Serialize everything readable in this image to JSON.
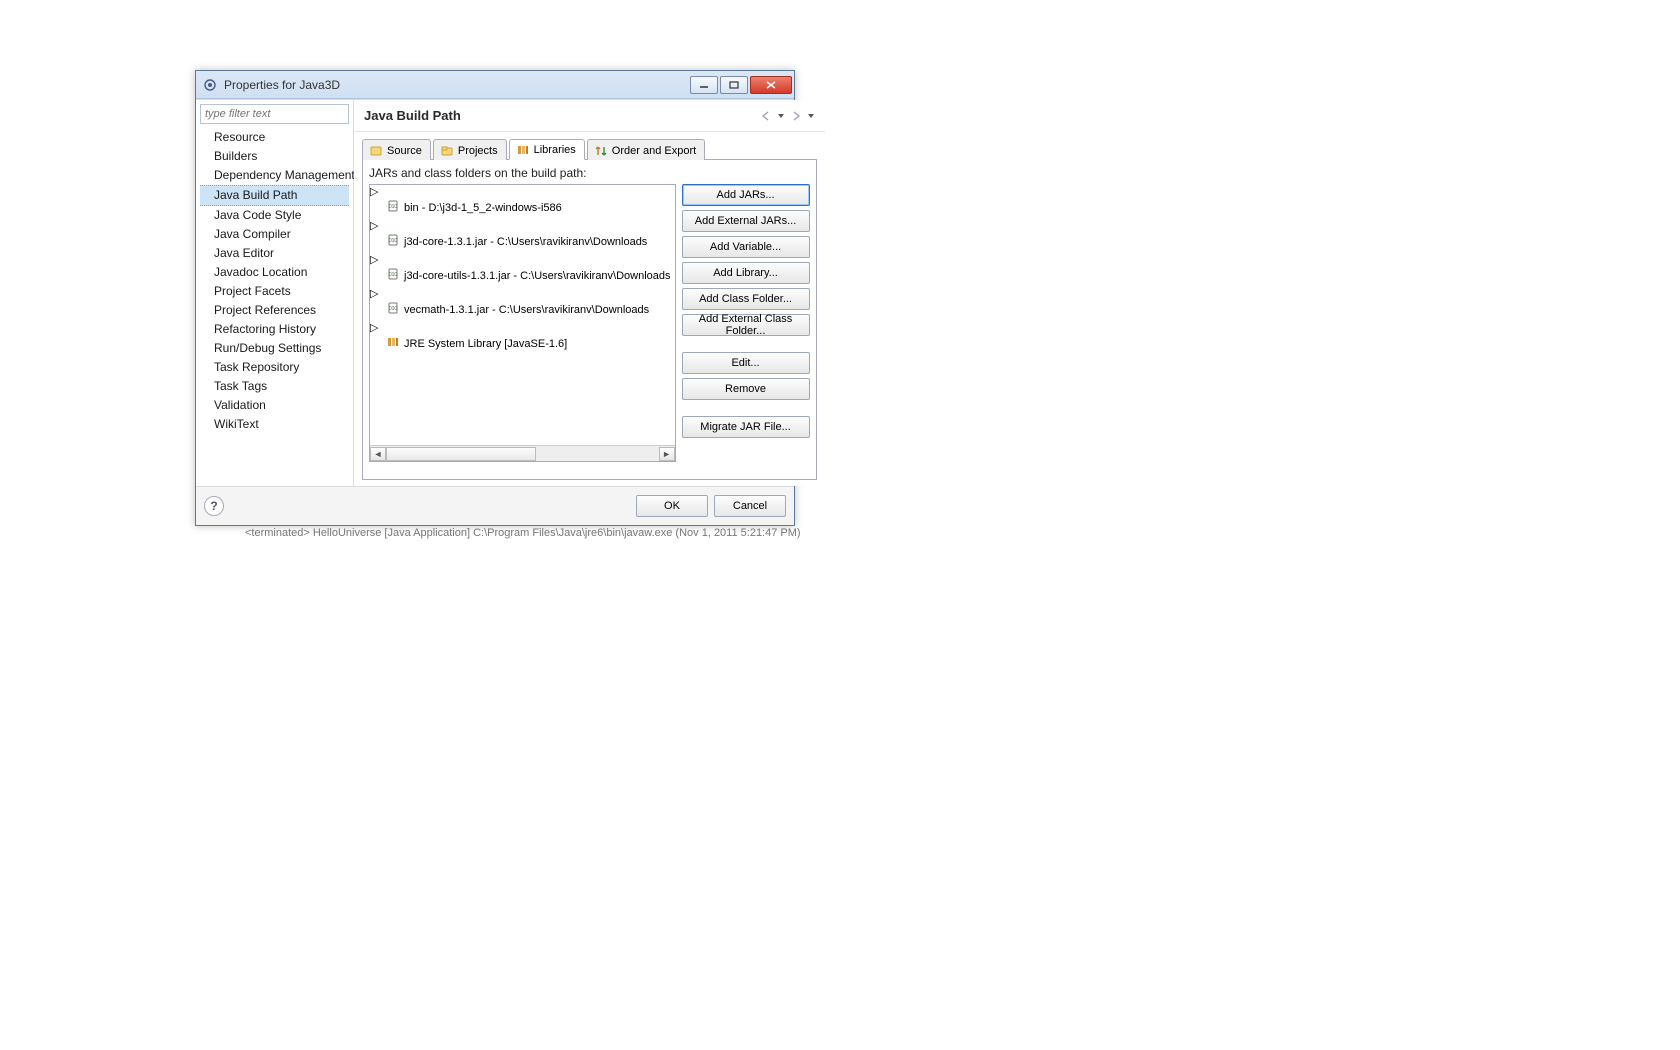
{
  "window": {
    "title": "Properties for Java3D"
  },
  "sidebar": {
    "filter_placeholder": "type filter text",
    "items": [
      {
        "label": "Resource"
      },
      {
        "label": "Builders"
      },
      {
        "label": "Dependency Management"
      },
      {
        "label": "Java Build Path",
        "selected": true
      },
      {
        "label": "Java Code Style"
      },
      {
        "label": "Java Compiler"
      },
      {
        "label": "Java Editor"
      },
      {
        "label": "Javadoc Location"
      },
      {
        "label": "Project Facets"
      },
      {
        "label": "Project References"
      },
      {
        "label": "Refactoring History"
      },
      {
        "label": "Run/Debug Settings"
      },
      {
        "label": "Task Repository"
      },
      {
        "label": "Task Tags"
      },
      {
        "label": "Validation"
      },
      {
        "label": "WikiText"
      }
    ]
  },
  "main": {
    "page_title": "Java Build Path",
    "tabs": [
      {
        "label": "Source",
        "icon": "source"
      },
      {
        "label": "Projects",
        "icon": "projects"
      },
      {
        "label": "Libraries",
        "icon": "libraries",
        "active": true
      },
      {
        "label": "Order and Export",
        "icon": "order"
      }
    ],
    "libraries": {
      "list_label": "JARs and class folders on the build path:",
      "entries": [
        {
          "text": "bin - D:\\j3d-1_5_2-windows-i586",
          "icon": "jar"
        },
        {
          "text": "j3d-core-1.3.1.jar - C:\\Users\\ravikiranv\\Downloads",
          "icon": "jar"
        },
        {
          "text": "j3d-core-utils-1.3.1.jar - C:\\Users\\ravikiranv\\Downloads",
          "icon": "jar"
        },
        {
          "text": "vecmath-1.3.1.jar - C:\\Users\\ravikiranv\\Downloads",
          "icon": "jar"
        },
        {
          "text": "JRE System Library [JavaSE-1.6]",
          "icon": "lib"
        }
      ],
      "buttons": {
        "add_jars": "Add JARs...",
        "add_external_jars": "Add External JARs...",
        "add_variable": "Add Variable...",
        "add_library": "Add Library...",
        "add_class_folder": "Add Class Folder...",
        "add_external_class_folder": "Add External Class Folder...",
        "edit": "Edit...",
        "remove": "Remove",
        "migrate": "Migrate JAR File..."
      }
    }
  },
  "footer": {
    "ok": "OK",
    "cancel": "Cancel",
    "help": "?"
  },
  "console": "<terminated> HelloUniverse [Java Application] C:\\Program Files\\Java\\jre6\\bin\\javaw.exe (Nov 1, 2011 5:21:47 PM)"
}
